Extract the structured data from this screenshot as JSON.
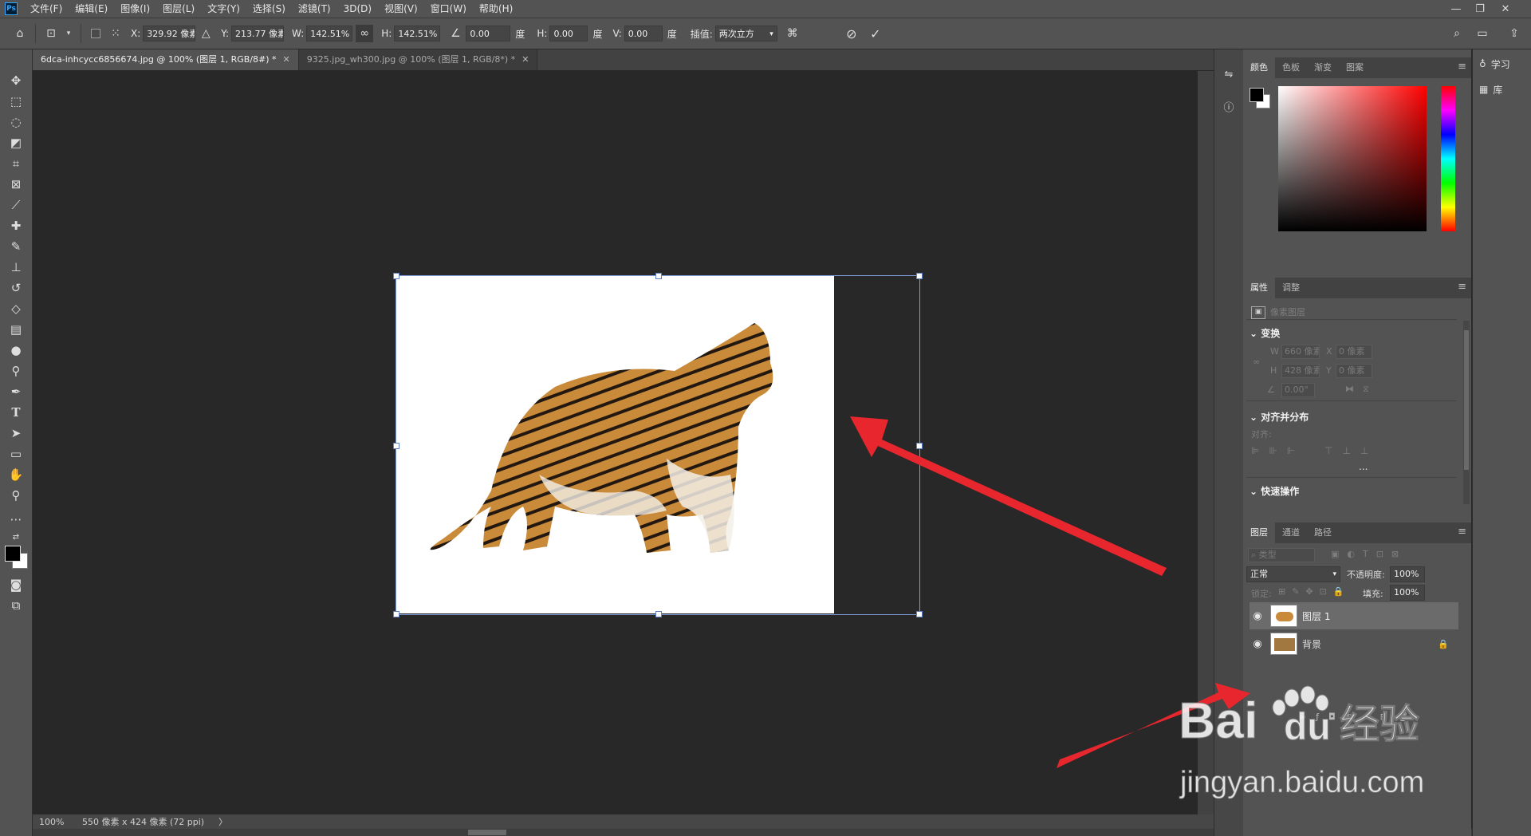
{
  "app": {
    "logo": "Ps"
  },
  "menu": [
    "文件(F)",
    "编辑(E)",
    "图像(I)",
    "图层(L)",
    "文字(Y)",
    "选择(S)",
    "滤镜(T)",
    "3D(D)",
    "视图(V)",
    "窗口(W)",
    "帮助(H)"
  ],
  "window_controls": [
    "—",
    "❐",
    "✕"
  ],
  "options": {
    "x_label": "X:",
    "x_value": "329.92 像素",
    "y_label": "Y:",
    "y_value": "213.77 像素",
    "w_label": "W:",
    "w_value": "142.51%",
    "h_label": "H:",
    "h_value": "142.51%",
    "angle_value": "0.00",
    "degree": "度",
    "skew_h_label": "H:",
    "skew_h_value": "0.00",
    "skew_v_label": "V:",
    "skew_v_value": "0.00",
    "interp_label": "插值:",
    "interp_value": "两次立方"
  },
  "tabs": [
    {
      "label": "6dca-inhcycc6856674.jpg @ 100% (图层 1, RGB/8#) *",
      "active": true
    },
    {
      "label": "9325.jpg_wh300.jpg @ 100% (图层 1, RGB/8*) *",
      "active": false
    }
  ],
  "status": {
    "zoom": "100%",
    "doc_info": "550 像素 x 424 像素 (72 ppi)",
    "arrow": "〉"
  },
  "color_panel": {
    "tabs": [
      "颜色",
      "色板",
      "渐变",
      "图案"
    ],
    "fg": "#000000",
    "bg": "#ffffff",
    "hue_color": "#ff0000"
  },
  "properties_panel": {
    "tabs": [
      "属性",
      "调整"
    ],
    "layer_type": "像素图层",
    "transform_title": "变换",
    "w_label": "W",
    "w_value": "660 像素",
    "x_label": "X",
    "x_value": "0 像素",
    "h_label": "H",
    "h_value": "428 像素",
    "y_label": "Y",
    "y_value": "0 像素",
    "angle_value": "0.00°",
    "align_title": "对齐并分布",
    "align_label": "对齐:",
    "quick_title": "快速操作",
    "more": "..."
  },
  "layers_panel": {
    "tabs": [
      "图层",
      "通道",
      "路径"
    ],
    "filter_placeholder": "类型",
    "blend_mode": "正常",
    "opacity_label": "不透明度:",
    "opacity_value": "100%",
    "lock_label": "锁定:",
    "fill_label": "填充:",
    "fill_value": "100%",
    "layers": [
      {
        "name": "图层 1",
        "selected": true
      },
      {
        "name": "背景",
        "selected": false
      }
    ]
  },
  "right_strip": {
    "learn": "学习",
    "library": "库"
  },
  "watermark": {
    "brand": "Bai",
    "du": "du",
    "jingyan": "经验",
    "url": "jingyan.baidu.com"
  },
  "colors": {
    "arrow": "#e8262e",
    "selection": "#7e9bd8"
  }
}
